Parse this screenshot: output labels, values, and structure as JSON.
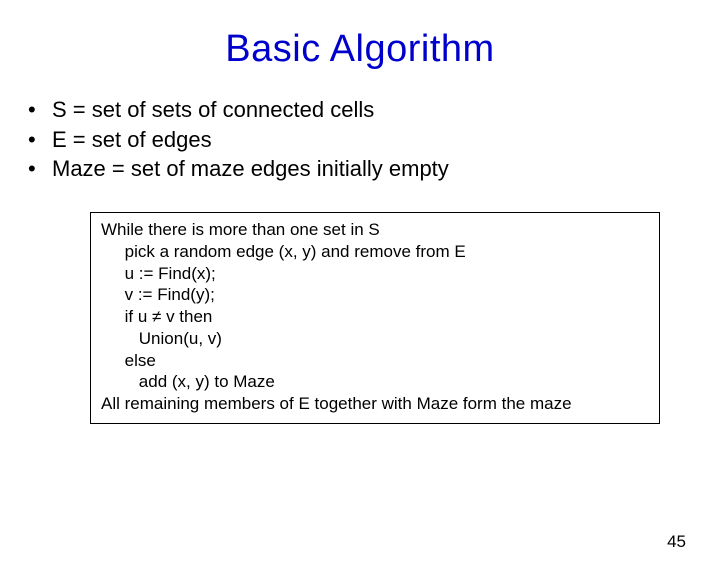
{
  "title": "Basic Algorithm",
  "bullets": [
    "S = set of sets of connected cells",
    "E = set of edges",
    "Maze = set of maze edges initially empty"
  ],
  "pseudocode": [
    "While there is more than one set in S",
    "     pick a random edge (x, y) and remove from E",
    "     u := Find(x);",
    "     v := Find(y);",
    "     if u ≠ v then",
    "        Union(u, v)",
    "     else",
    "        add (x, y) to Maze",
    "All remaining members of E together with Maze form the maze"
  ],
  "page_number": "45"
}
